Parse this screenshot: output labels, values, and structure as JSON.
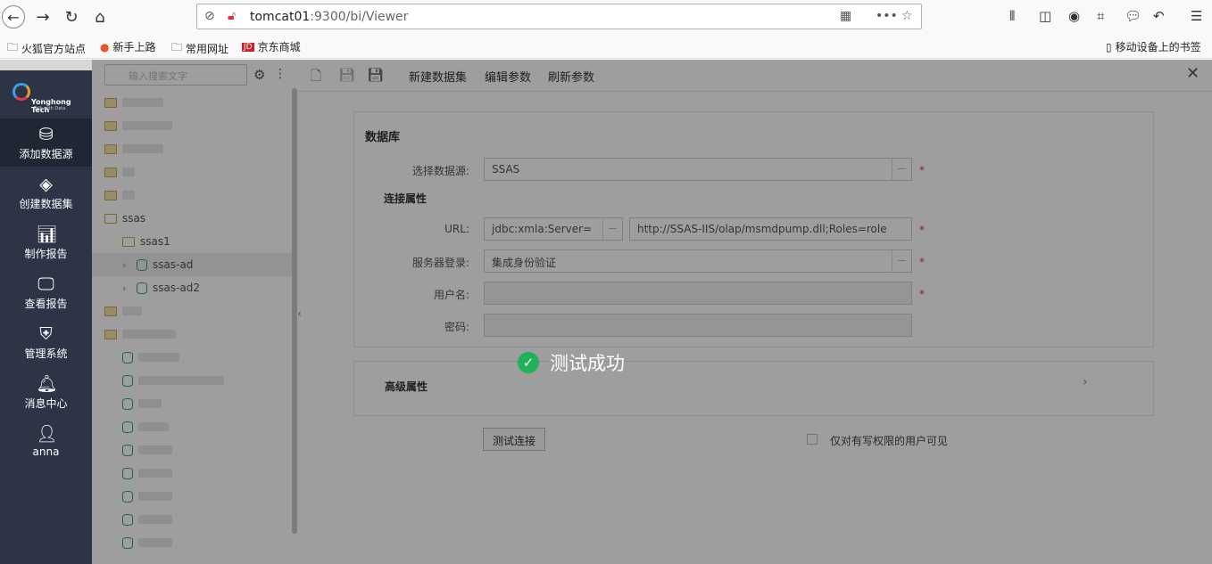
{
  "browser": {
    "url_host": "tomcat01",
    "url_rest": ":9300/bi/Viewer",
    "bookmarks": [
      "火狐官方站点",
      "新手上路",
      "常用网址",
      "京东商城"
    ],
    "mobile_bookmarks": "移动设备上的书签"
  },
  "left_nav": {
    "brand": "Yonghong Tech",
    "tagline": "Talk with Data",
    "items": [
      {
        "label": "添加数据源",
        "icon": "database-icon"
      },
      {
        "label": "创建数据集",
        "icon": "layers-icon"
      },
      {
        "label": "制作报告",
        "icon": "chart-icon"
      },
      {
        "label": "查看报告",
        "icon": "monitor-chart-icon"
      },
      {
        "label": "管理系统",
        "icon": "shield-user-icon"
      },
      {
        "label": "消息中心",
        "icon": "bell-icon"
      },
      {
        "label": "anna",
        "icon": "user-icon"
      }
    ]
  },
  "tree": {
    "search_placeholder": "输入搜索文字",
    "rows": [
      {
        "label": "ssas"
      },
      {
        "label": "ssas1"
      },
      {
        "label": "ssas-ad"
      },
      {
        "label": "ssas-ad2"
      }
    ]
  },
  "toolbar": {
    "new_dataset": "新建数据集",
    "edit_params": "编辑参数",
    "refresh_params": "刷新参数"
  },
  "form": {
    "section_db": "数据库",
    "select_source_label": "选择数据源:",
    "select_source_value": "SSAS",
    "section_conn": "连接属性",
    "url_label": "URL:",
    "url_prefix": "jdbc:xmla:Server=",
    "url_value": "http://SSAS-IIS/olap/msmdpump.dll;Roles=role",
    "server_login_label": "服务器登录:",
    "server_login_value": "集成身份验证",
    "username_label": "用户名:",
    "password_label": "密码:",
    "required_mark": "*",
    "advanced": "高级属性",
    "test_button": "测试连接",
    "visible_checkbox": "仅对有写权限的用户可见"
  },
  "toast": {
    "message": "测试成功"
  }
}
